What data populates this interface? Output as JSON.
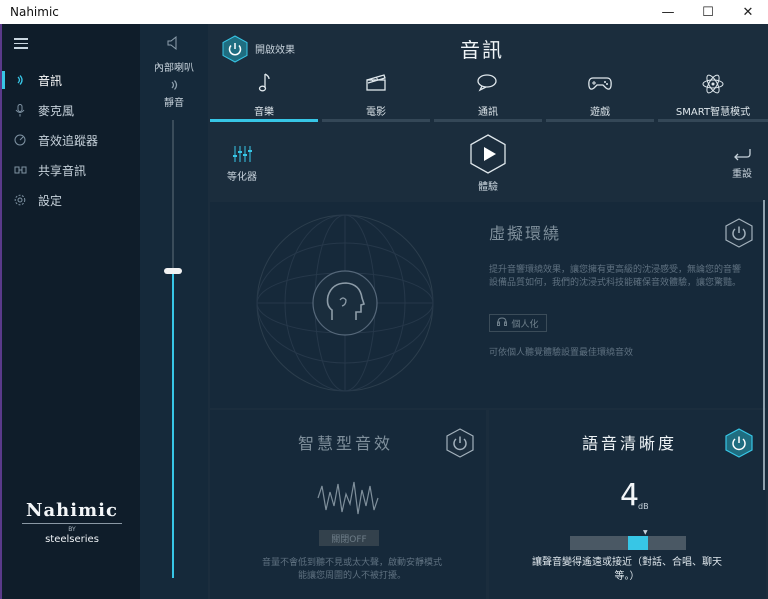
{
  "window": {
    "title": "Nahimic",
    "minimize_glyph": "—",
    "maximize_glyph": "☐",
    "close_glyph": "✕"
  },
  "nav": {
    "items": [
      {
        "label": "音訊",
        "icon": "audio-icon",
        "active": true
      },
      {
        "label": "麥克風",
        "icon": "microphone-icon",
        "active": false
      },
      {
        "label": "音效追蹤器",
        "icon": "sound-tracker-icon",
        "active": false
      },
      {
        "label": "共享音訊",
        "icon": "share-audio-icon",
        "active": false
      },
      {
        "label": "設定",
        "icon": "gear-icon",
        "active": false
      }
    ]
  },
  "brand": {
    "logo": "Nahimic",
    "by": "BY",
    "company": "steelseries"
  },
  "device": {
    "speaker_label": "內部喇叭",
    "mute_label": "靜音",
    "volume_percent": 67
  },
  "header": {
    "power_label": "開啟效果",
    "title": "音訊"
  },
  "tabs": [
    {
      "label": "音樂",
      "icon": "music-note-icon",
      "active": true
    },
    {
      "label": "電影",
      "icon": "clapperboard-icon",
      "active": false
    },
    {
      "label": "通訊",
      "icon": "chat-icon",
      "active": false
    },
    {
      "label": "遊戲",
      "icon": "gamepad-icon",
      "active": false
    },
    {
      "label": "SMART智慧模式",
      "icon": "atom-icon",
      "active": false
    }
  ],
  "toolbar": {
    "equalizer_label": "等化器",
    "experience_label": "體驗",
    "reset_label": "重設"
  },
  "surround": {
    "title": "虛擬環繞",
    "description": "提升音響環繞效果，讓您擁有更高級的沈浸感受，無論您的音響設備品質如何，我們的沈浸式科技能確保音效體驗，讓您驚豔。",
    "personalize_label": "個人化",
    "note": "可依個人聽覺體驗設置最佳環繞音效"
  },
  "smart_volume": {
    "title": "智慧型音效",
    "off_label": "關閉OFF",
    "description": "音量不會低到聽不見或太大聲，啟動安靜模式能讓您周圍的人不被打擾。"
  },
  "voice_clarity": {
    "title": "語音清晰度",
    "value": "4",
    "unit": "dB",
    "level_fraction": 0.5,
    "description": "讓聲音變得遙遠或接近（對話、合唱、聊天等。）"
  },
  "colors": {
    "accent": "#37c6e6",
    "background": "#1b2d3d",
    "nav_background": "#0f1d2a"
  }
}
